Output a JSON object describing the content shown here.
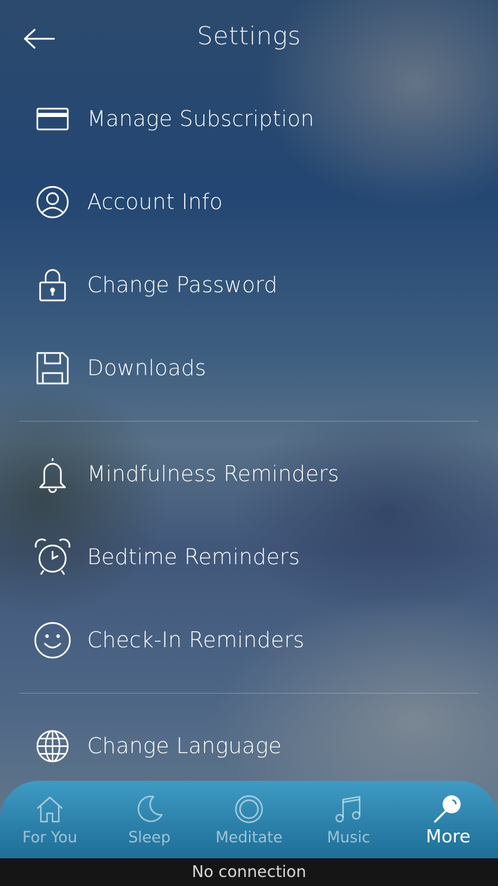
{
  "header": {
    "title": "Settings",
    "back_icon": "arrow-left-icon"
  },
  "menu": {
    "group1": [
      {
        "label": "Manage Subscription",
        "icon": "credit-card-icon"
      },
      {
        "label": "Account Info",
        "icon": "user-circle-icon"
      },
      {
        "label": "Change Password",
        "icon": "lock-icon"
      },
      {
        "label": "Downloads",
        "icon": "floppy-disk-icon"
      }
    ],
    "group2": [
      {
        "label": "Mindfulness Reminders",
        "icon": "bell-icon"
      },
      {
        "label": "Bedtime Reminders",
        "icon": "alarm-clock-icon"
      },
      {
        "label": "Check-In Reminders",
        "icon": "smiley-icon"
      }
    ],
    "group3": [
      {
        "label": "Change Language",
        "icon": "globe-icon"
      }
    ]
  },
  "tabbar": {
    "tabs": [
      {
        "label": "For You",
        "icon": "home-icon",
        "active": false
      },
      {
        "label": "Sleep",
        "icon": "moon-icon",
        "active": false
      },
      {
        "label": "Meditate",
        "icon": "ring-icon",
        "active": false
      },
      {
        "label": "Music",
        "icon": "music-note-icon",
        "active": false
      },
      {
        "label": "More",
        "icon": "magnifier-icon",
        "active": true
      }
    ]
  },
  "status": {
    "text": "No connection"
  },
  "colors": {
    "tabbar": "#2a7fa8",
    "status_bar": "#151515"
  }
}
